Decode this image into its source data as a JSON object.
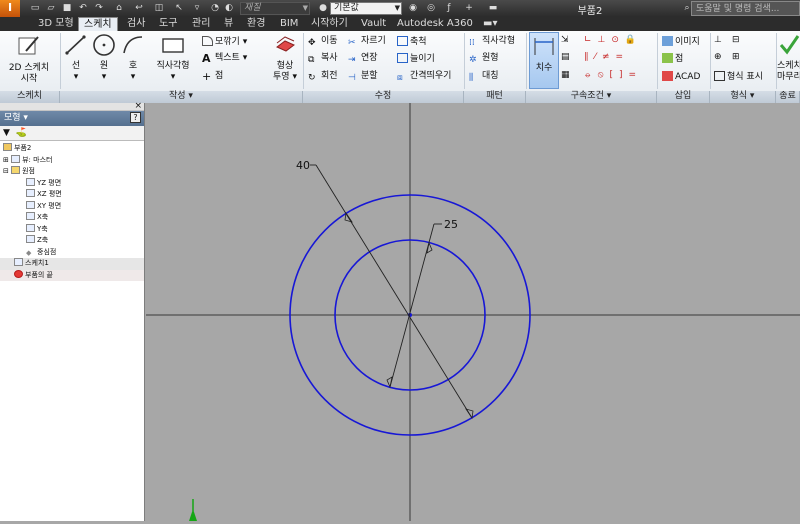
{
  "titlebar": {
    "app_logo": "I",
    "material_combo": "재질",
    "appearance_combo": "기본값",
    "doc_title": "부품2",
    "help_search_placeholder": "도움말 및 명령 검색..."
  },
  "tabs": [
    "3D 모형",
    "스케치",
    "검사",
    "도구",
    "관리",
    "뷰",
    "환경",
    "BIM",
    "시작하기",
    "Vault",
    "Autodesk A360"
  ],
  "active_tab": "스케치",
  "ribbon": {
    "panel_titles": {
      "sketch": "스케치",
      "create": "작성 ▾",
      "modify": "수정",
      "pattern": "패턴",
      "constrain": "구속조건 ▾",
      "insert": "삽입",
      "format": "형식 ▾",
      "exit": "종료"
    },
    "sketch": {
      "start_2d_line1": "2D 스케치",
      "start_2d_line2": "시작"
    },
    "create": {
      "line": "선",
      "circle": "원",
      "arc": "호",
      "rectangle": "직사각형",
      "fillet": "모깎기",
      "text": "텍스트",
      "point": "점",
      "project_line1": "형상",
      "project_line2": "투영"
    },
    "modify": {
      "move": "이동",
      "trim": "자르기",
      "scale": "축척",
      "copy": "복사",
      "extend": "연장",
      "stretch": "늘이기",
      "rotate": "회전",
      "split": "분할",
      "offset": "간격띄우기"
    },
    "pattern": {
      "rectangular": "직사각형",
      "circular": "원형",
      "mirror": "대칭"
    },
    "constrain": {
      "dimension": "치수"
    },
    "insert": {
      "image": "이미지",
      "points": "점",
      "acad": "ACAD"
    },
    "format": {
      "format_display": "형식 표시"
    },
    "exit": {
      "finish_line1": "스케치",
      "finish_line2": "마무리"
    }
  },
  "browser": {
    "header": "모형 ▾",
    "help": "?",
    "close": "×",
    "toolbar_filter": "▼",
    "toolbar_find": "⛳",
    "items": [
      "부품2",
      "뷰: 마스터",
      "원점",
      "YZ 평면",
      "XZ 평면",
      "XY 평면",
      "X축",
      "Y축",
      "Z축",
      "중심점",
      "스케치1",
      "부품의 끝"
    ]
  },
  "canvas": {
    "dim_outer": "40",
    "dim_inner": "25"
  },
  "colors": {
    "sketch_curve": "#1717d6",
    "canvas_bg": "#a7a7a7",
    "axis": "#3a3a3a",
    "ucs_green": "#16a616"
  }
}
